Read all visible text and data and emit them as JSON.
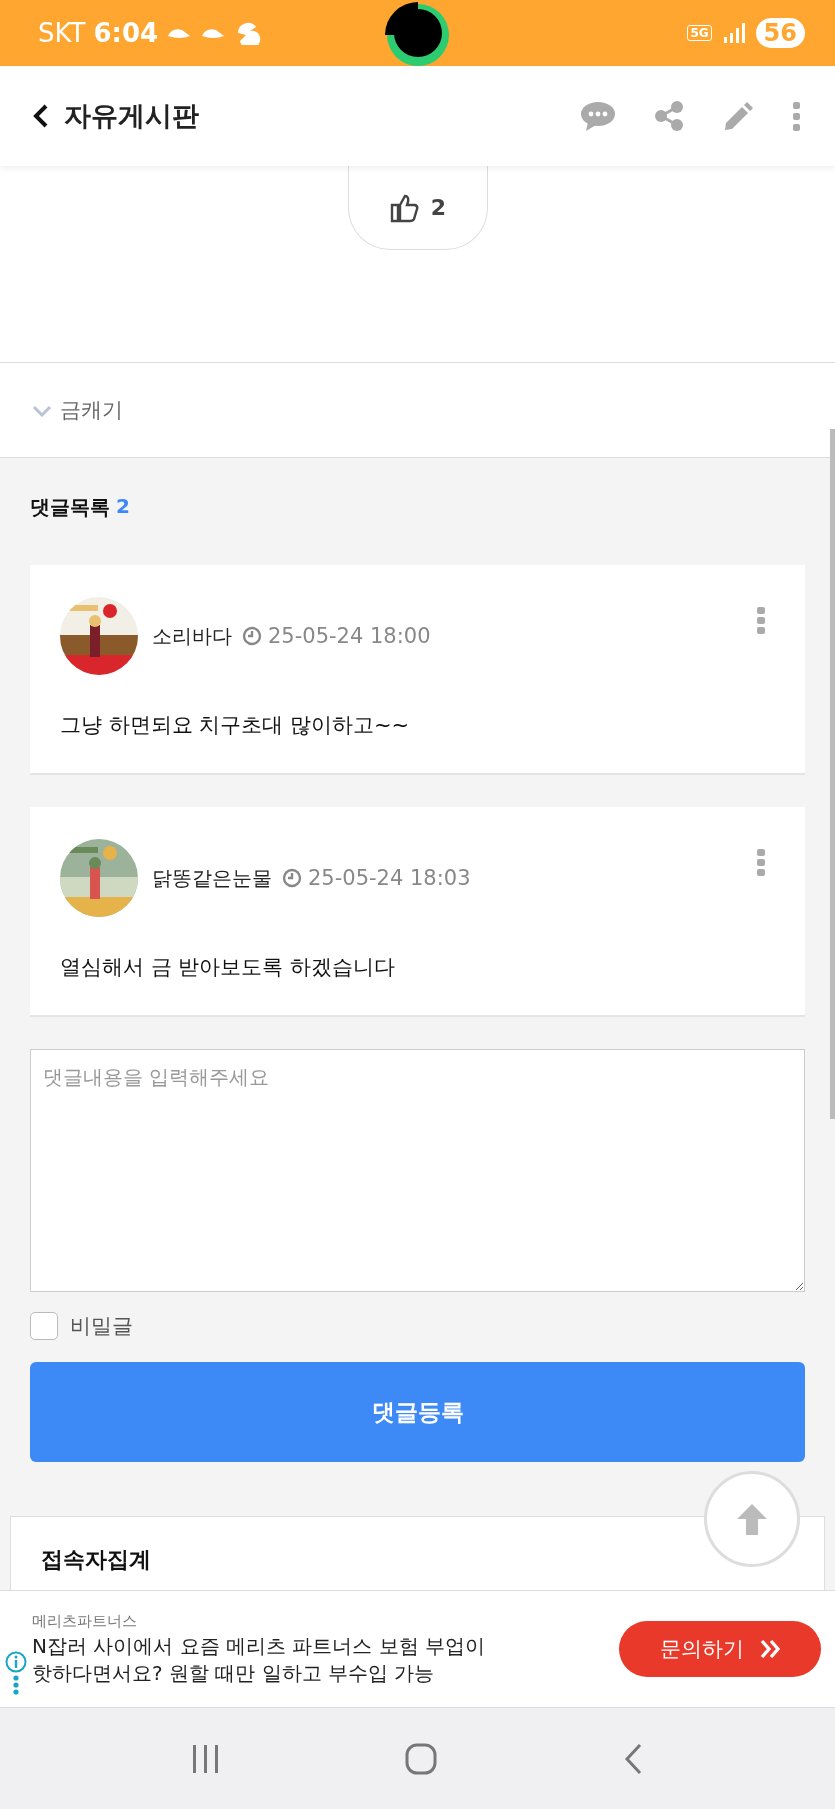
{
  "status_bar": {
    "carrier": "SKT",
    "time": "6:04",
    "network": "5G",
    "battery": "56"
  },
  "header": {
    "title": "자유게시판"
  },
  "like": {
    "count": "2"
  },
  "category": {
    "label": "금캐기"
  },
  "comments": {
    "heading": "댓글목록",
    "count": "2",
    "items": [
      {
        "author": "소리바다",
        "time": "25-05-24 18:00",
        "body": "그냥 하면되요 치구초대 많이하고~~"
      },
      {
        "author": "닭똥같은눈물",
        "time": "25-05-24 18:03",
        "body": "열심해서 금 받아보도록 하겠습니다"
      }
    ]
  },
  "comment_form": {
    "placeholder": "댓글내용을 입력해주세요",
    "secret": {
      "label": "비밀글",
      "checked": false
    },
    "submit": "댓글등록"
  },
  "widget": {
    "title": "접속자집계"
  },
  "ad": {
    "advertiser": "메리츠파트너스",
    "text": "N잡러 사이에서 요즘 메리츠 파트너스 보험 부업이 핫하다면서요? 원할 때만 일하고 부수입 가능",
    "button": "문의하기"
  }
}
